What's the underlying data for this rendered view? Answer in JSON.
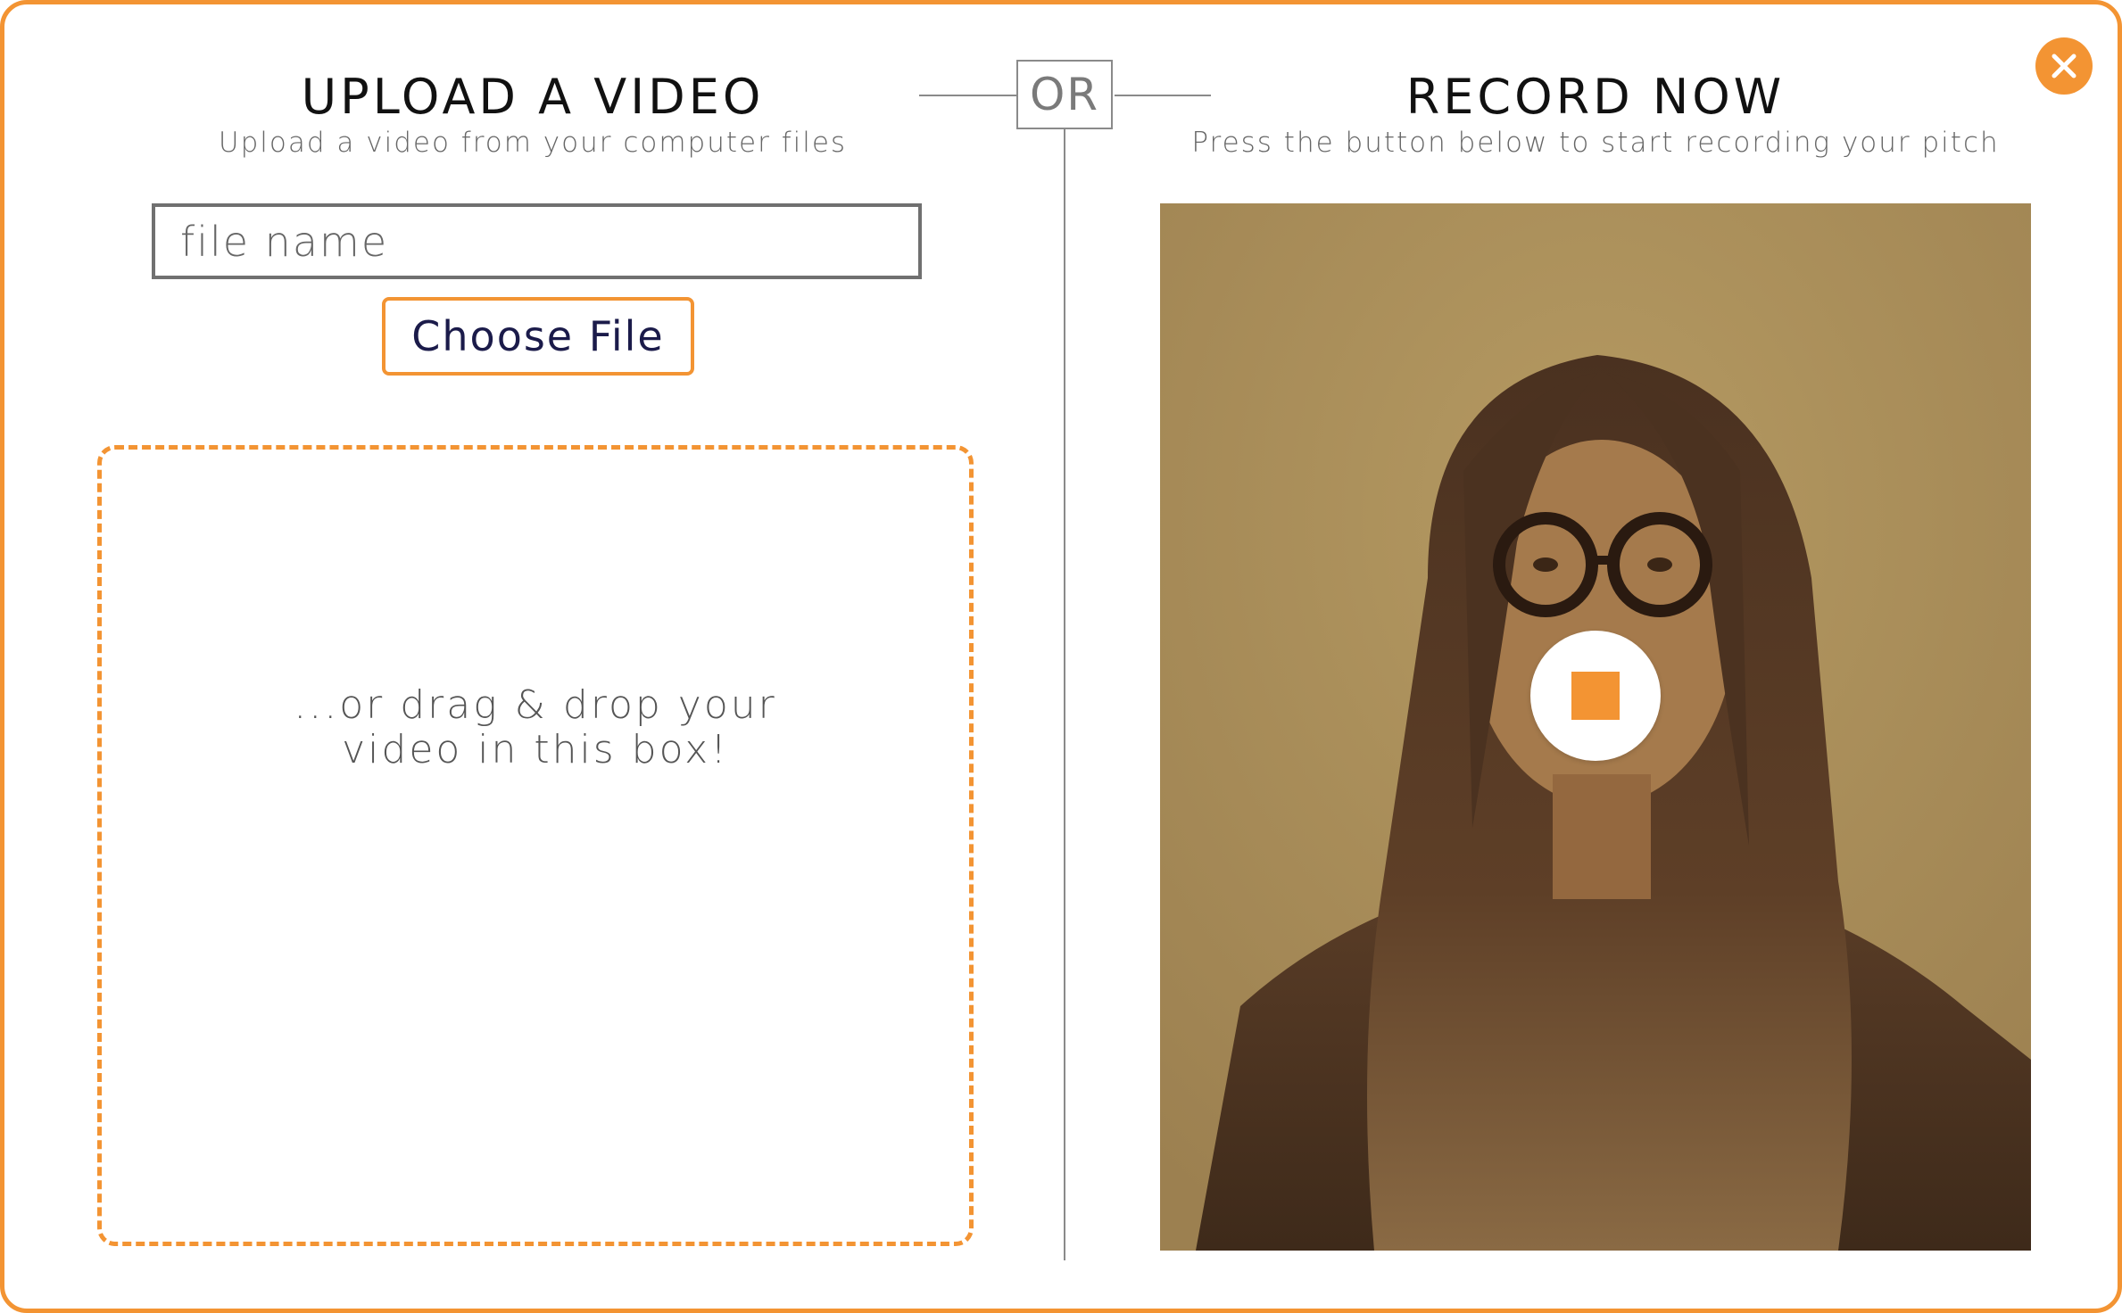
{
  "upload": {
    "title": "UPLOAD A VIDEO",
    "subtitle": "Upload a video from your computer files",
    "file_name_placeholder": "file name",
    "file_name_value": "",
    "choose_file_label": "Choose File",
    "drop_text_line1": "...or drag & drop your",
    "drop_text_line2": "video in this box!"
  },
  "divider": {
    "or_label": "OR"
  },
  "record": {
    "title": "RECORD NOW",
    "subtitle": "Press the button below to start recording your pitch",
    "stop_icon": "stop-square-icon"
  },
  "close": {
    "icon": "close-icon"
  },
  "colors": {
    "accent": "#f39433",
    "text_dark": "#111111",
    "text_muted": "#666666",
    "button_text": "#1b1b4a",
    "divider": "#8a8a8a"
  }
}
